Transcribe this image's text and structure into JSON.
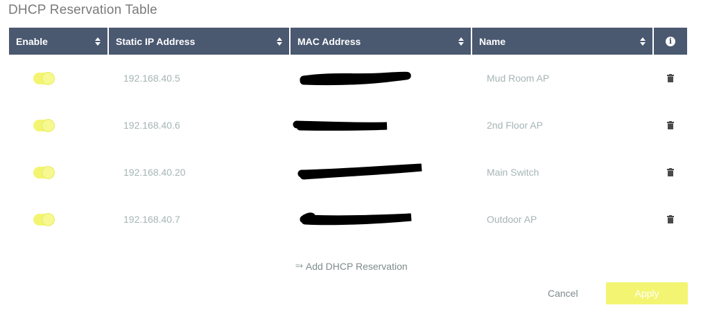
{
  "title": "DHCP Reservation Table",
  "columns": {
    "enable": "Enable",
    "ip": "Static IP Address",
    "mac": "MAC Address",
    "name": "Name"
  },
  "rows": [
    {
      "enabled": true,
      "ip": "192.168.40.5",
      "name": "Mud Room AP",
      "mac_redacted": true
    },
    {
      "enabled": true,
      "ip": "192.168.40.6",
      "name": "2nd Floor AP",
      "mac_redacted": true
    },
    {
      "enabled": true,
      "ip": "192.168.40.20",
      "name": "Main Switch",
      "mac_redacted": true
    },
    {
      "enabled": true,
      "ip": "192.168.40.7",
      "name": "Outdoor AP",
      "mac_redacted": true
    }
  ],
  "actions": {
    "add_label": "Add DHCP Reservation",
    "cancel_label": "Cancel",
    "apply_label": "Apply"
  },
  "icons": {
    "sort": "sort-icon",
    "info": "info-icon",
    "delete": "trash-icon",
    "add": "add-row-icon"
  },
  "colors": {
    "header_bg": "#4a5870",
    "toggle_on": "#f3f572",
    "apply_bg": "#f3f572",
    "muted_text": "#a6b4b4"
  }
}
